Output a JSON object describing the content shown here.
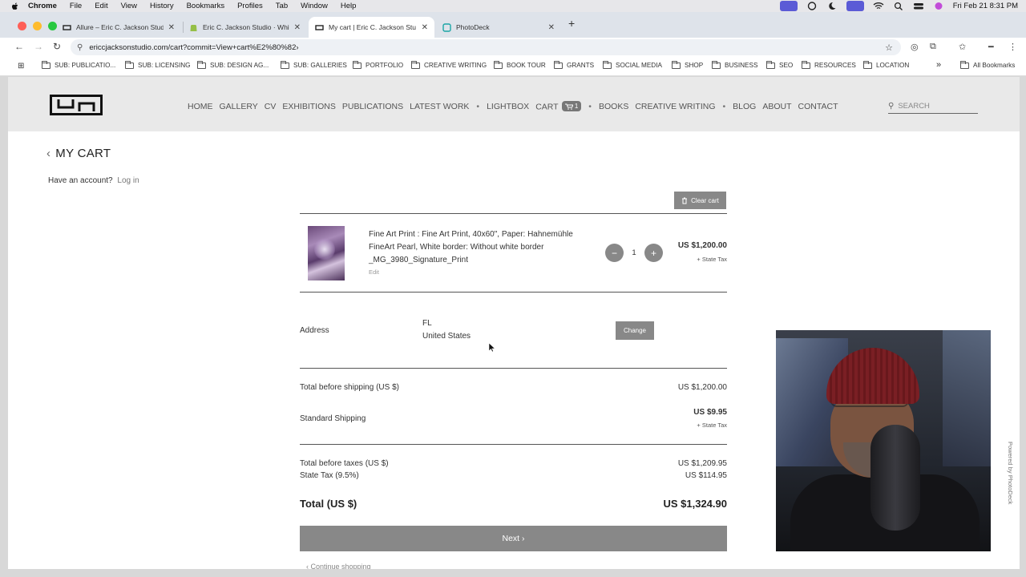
{
  "menubar": {
    "app": "Chrome",
    "items": [
      "File",
      "Edit",
      "View",
      "History",
      "Bookmarks",
      "Profiles",
      "Tab",
      "Window",
      "Help"
    ],
    "clock": "Fri Feb 21  8:31 PM"
  },
  "tabs": [
    {
      "title": "Allure – Eric C. Jackson Studi"
    },
    {
      "title": "Eric C. Jackson Studio · Whit"
    },
    {
      "title": "My cart | Eric C. Jackson Stu"
    },
    {
      "title": "PhotoDeck"
    }
  ],
  "address_bar": {
    "url": "ericcjacksonstudio.com/cart?commit=View+cart%E2%80%82›"
  },
  "bookmarks": {
    "items": [
      "SUB: PUBLICATIO...",
      "SUB: LICENSING",
      "SUB: DESIGN AG...",
      "SUB: GALLERIES",
      "PORTFOLIO",
      "CREATIVE WRITING",
      "BOOK TOUR",
      "GRANTS",
      "SOCIAL MEDIA",
      "SHOP",
      "BUSINESS",
      "SEO",
      "RESOURCES",
      "LOCATION"
    ],
    "overflow": "»",
    "all": "All Bookmarks"
  },
  "site_nav": {
    "items": [
      "HOME",
      "GALLERY",
      "CV",
      "EXHIBITIONS",
      "PUBLICATIONS",
      "LATEST WORK",
      "LIGHTBOX",
      "CART",
      "BOOKS",
      "CREATIVE WRITING",
      "BLOG",
      "ABOUT",
      "CONTACT"
    ],
    "cart_count": "1",
    "search_placeholder": "SEARCH"
  },
  "cart": {
    "title": "MY CART",
    "account_prompt": "Have an account?",
    "login_label": "Log in",
    "clear_label": "Clear cart",
    "item": {
      "line1": "Fine Art Print : Fine Art Print, 40x60\", Paper: Hahnemühle",
      "line2": "FineArt Pearl, White border: Without white border",
      "line3": "_MG_3980_Signature_Print",
      "edit": "Edit",
      "quantity": "1",
      "minus": "−",
      "plus": "+",
      "price": "US $1,200.00",
      "tax_note": "+ State Tax"
    },
    "address": {
      "label": "Address",
      "line1": "FL",
      "line2": "United States",
      "change_label": "Change"
    },
    "summary": {
      "before_shipping_label": "Total before shipping (US $)",
      "before_shipping_value": "US $1,200.00",
      "shipping_label": "Standard Shipping",
      "shipping_value": "US $9.95",
      "shipping_tax_note": "+ State Tax",
      "before_taxes_label": "Total before taxes (US $)",
      "before_taxes_value": "US $1,209.95",
      "tax_label": "State Tax (9.5%)",
      "tax_value": "US $114.95",
      "total_label": "Total (US $)",
      "total_value": "US $1,324.90"
    },
    "next_label": "Next ›",
    "continue_label": "‹ Continue shopping"
  },
  "powered_by": "Powered by PhotoDeck"
}
